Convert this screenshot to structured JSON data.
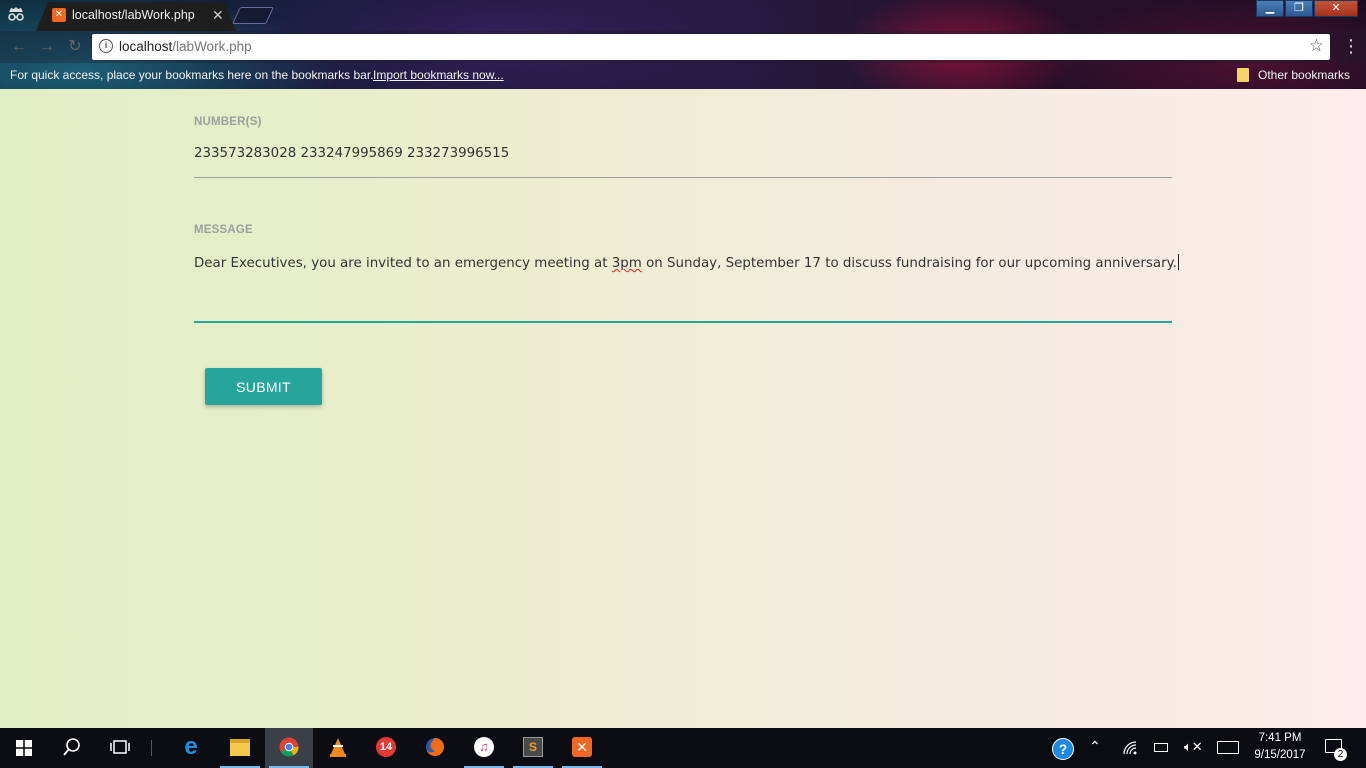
{
  "browser": {
    "tab_title": "localhost/labWork.php",
    "url_host": "localhost",
    "url_path": "/labWork.php",
    "bookmarks_bar_text": "For quick access, place your bookmarks here on the bookmarks bar.",
    "import_bookmarks_link": "Import bookmarks now...",
    "other_bookmarks": "Other bookmarks"
  },
  "form": {
    "numbers_label": "NUMBER(S)",
    "numbers_value": "233573283028 233247995869 233273996515",
    "message_label": "MESSAGE",
    "message_before": "Dear Executives, you are invited to an emergency meeting at ",
    "message_misspelled": "3pm",
    "message_after": " on Sunday, September 17 to discuss fundraising for our upcoming anniversary.",
    "submit_label": "SUBMIT"
  },
  "colors": {
    "accent": "#26a69a",
    "page_bg_left": "#e1efc4",
    "page_bg_right": "#fcebea"
  },
  "taskbar": {
    "apps": [
      "start-icon",
      "search-icon",
      "task-view-icon",
      "edge-icon",
      "file-explorer-icon",
      "chrome-icon",
      "vlc-icon",
      "app-14-icon",
      "firefox-icon",
      "itunes-icon",
      "sublime-text-icon",
      "xampp-icon"
    ],
    "time": "7:41 PM",
    "date": "9/15/2017",
    "notification_count": "2"
  }
}
